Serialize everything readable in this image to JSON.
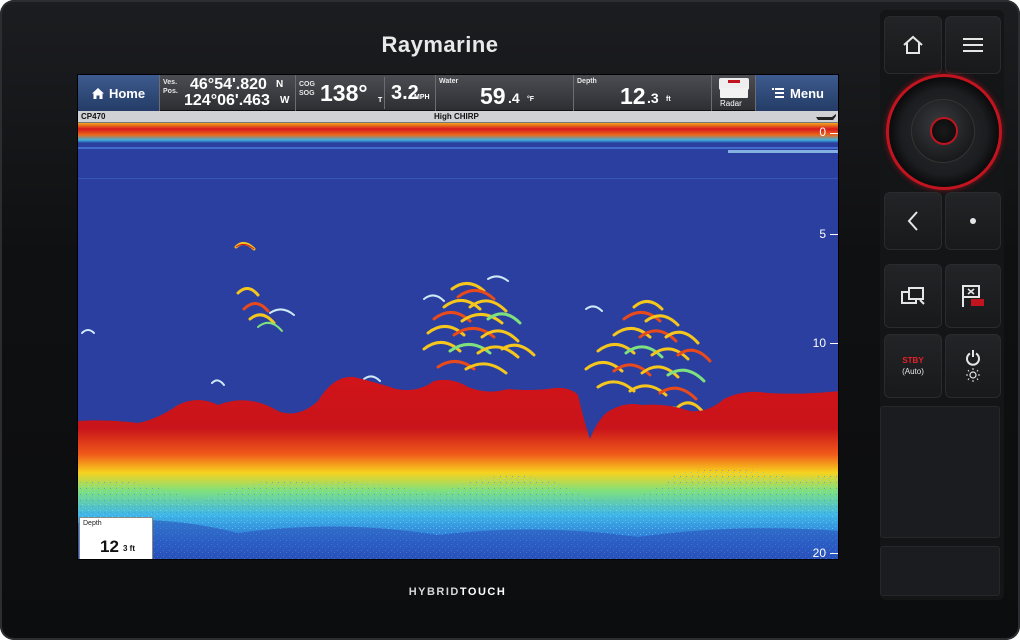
{
  "device": {
    "brand": "Raymarine",
    "model_prefix": "HYBRID",
    "model_suffix": "TOUCH"
  },
  "databar": {
    "home_label": "Home",
    "position": {
      "label_top": "Ves.",
      "label_bottom": "Pos.",
      "lat": "46°54'.820",
      "lat_dir": "N",
      "lon": "124°06'.463",
      "lon_dir": "W"
    },
    "course": {
      "label_top": "COG",
      "label_bottom": "SOG",
      "cog": "138°",
      "cog_unit": "T",
      "sog": "3.2",
      "sog_unit": "MPH"
    },
    "water": {
      "label": "Water",
      "value_int": "59",
      "value_dec": ".4",
      "unit": "°F"
    },
    "depth": {
      "label": "Depth",
      "value_int": "12",
      "value_dec": ".3",
      "unit": "ft"
    },
    "radar_label": "Radar",
    "menu_label": "Menu"
  },
  "infobar": {
    "transducer": "CP470",
    "mode": "High CHIRP"
  },
  "depth_scale": {
    "labels": [
      "0",
      "5",
      "10",
      "20"
    ]
  },
  "depth_readout": {
    "label": "Depth",
    "value": "12",
    "unit": "3 ft"
  },
  "panel": {
    "stby_label": "STBY",
    "auto_label": "(Auto)"
  },
  "colors": {
    "water": "#2a3f9f",
    "bottom_strong": "#c8141a",
    "accent_red": "#c2141f",
    "bar_blue": "#2d4a7a"
  }
}
